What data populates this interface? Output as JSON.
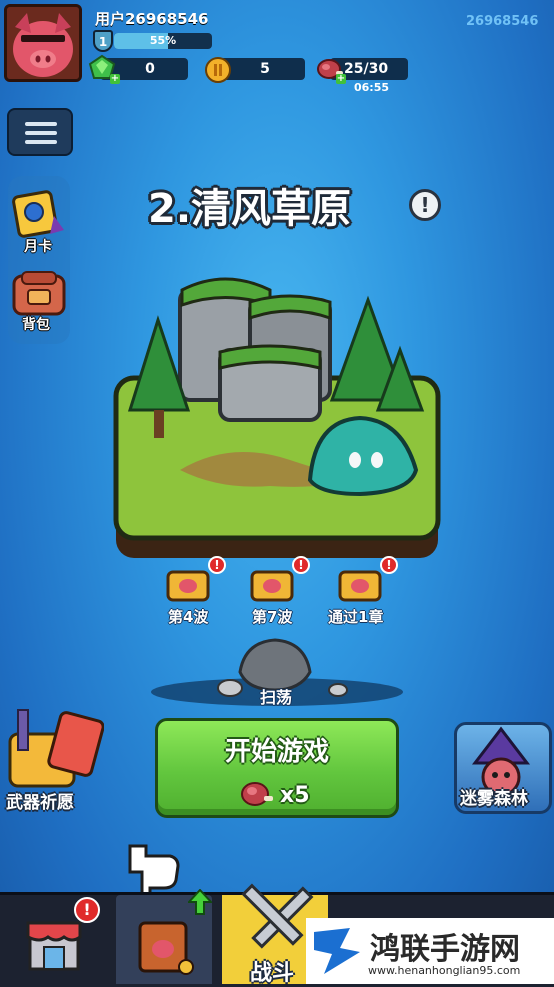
{
  "player": {
    "username": "用户26968546",
    "top_id": "26968546",
    "level": "1",
    "xp_percent_label": "55%",
    "xp_fraction": 0.55
  },
  "resources": {
    "gems": "0",
    "coins": "5",
    "stamina": "25/30",
    "stamina_timer": "06:55"
  },
  "side_menu": {
    "monthly_card": "月卡",
    "backpack": "背包"
  },
  "stage": {
    "title": "2.清风草原",
    "info_symbol": "!"
  },
  "rewards": [
    {
      "label": "第4波"
    },
    {
      "label": "第7波"
    },
    {
      "label": "通过1章"
    }
  ],
  "sweep_label": "扫荡",
  "start_button": {
    "label": "开始游戏",
    "cost": "x5"
  },
  "weapon_pray_label": "武器祈愿",
  "mist_forest_label": "迷雾森林",
  "bottom_nav": {
    "battle_label": "战斗"
  },
  "watermark": {
    "name": "鸿联手游网",
    "url": "www.henanhonglian95.com"
  },
  "colors": {
    "background": "#2f97e0",
    "start_button": "#62c63e",
    "alert_badge": "#e02a2a"
  }
}
